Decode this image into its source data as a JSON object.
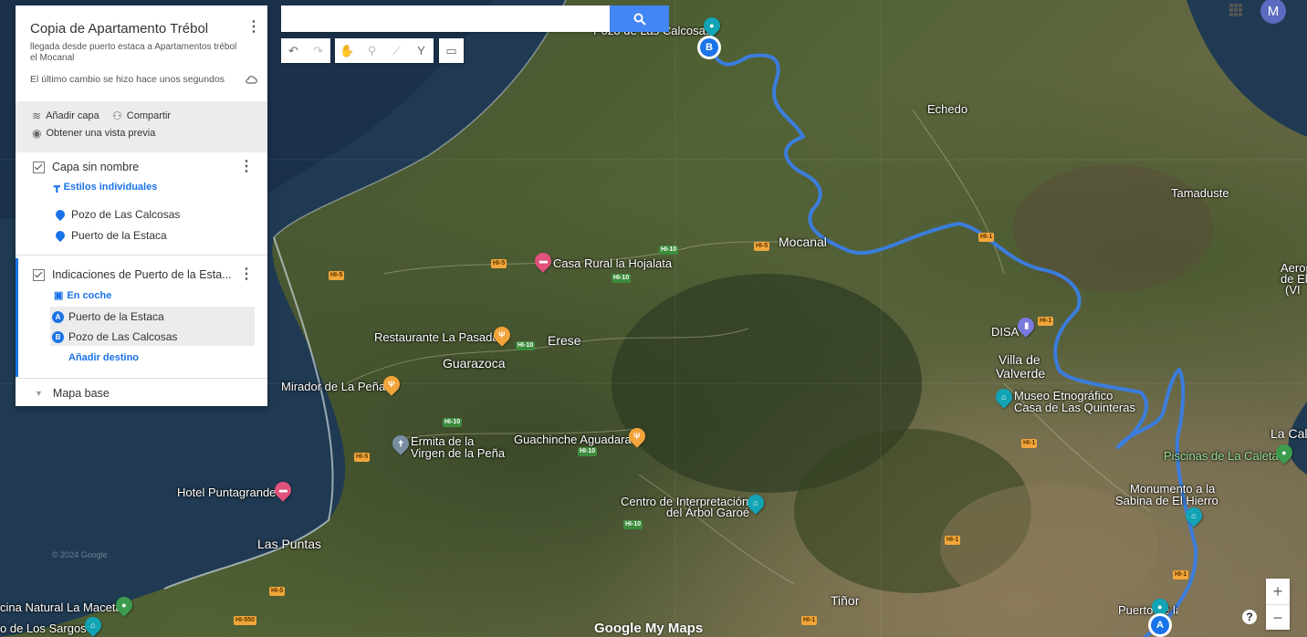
{
  "search": {
    "placeholder": ""
  },
  "toolbar": {
    "undo_icon": "undo-icon",
    "redo_icon": "redo-icon",
    "tools": [
      "hand-icon",
      "marker-icon",
      "draw-line-icon",
      "route-icon",
      "ruler-icon"
    ]
  },
  "panel": {
    "title": "Copia de Apartamento Trébol",
    "description": "llegada desde puerto estaca a Apartamentos trébol el Mocanal",
    "last_saved": "El último cambio se hizo hace unos segundos",
    "add_layer": "Añadir capa",
    "share": "Compartir",
    "preview": "Obtener una vista previa",
    "layer1": {
      "name": "Capa sin nombre",
      "style_link": "Estilos individuales",
      "items": [
        "Pozo de Las Calcosas",
        "Puerto de la Estaca"
      ]
    },
    "layer2": {
      "name": "Indicaciones de Puerto de la Esta...",
      "mode": "En coche",
      "stops": [
        {
          "badge": "A",
          "label": "Puerto de la Estaca"
        },
        {
          "badge": "B",
          "label": "Pozo de Las Calcosas"
        }
      ],
      "add_destination": "Añadir destino"
    },
    "base_map": "Mapa base"
  },
  "user": {
    "initial": "M"
  },
  "zoom": {
    "in": "+",
    "out": "−"
  },
  "help": "?",
  "brand": "Google My Maps",
  "copyright": "© 2024 Google",
  "places": {
    "pozo": "Pozo de Las Calcosas",
    "echedo": "Echedo",
    "tamaduste": "Tamaduste",
    "mocanal": "Mocanal",
    "casa_rural": "Casa Rural la Hojalata",
    "restaurante": "Restaurante La Pasada",
    "erese": "Erese",
    "guarazoca": "Guarazoca",
    "mirador": "Mirador de La Peña",
    "ermita1": "Ermita de la",
    "ermita2": "Virgen de la Peña",
    "guachinche": "Guachinche Aguadara",
    "hotel": "Hotel Puntagrande",
    "las_puntas": "Las Puntas",
    "centro1": "Centro de Interpretación",
    "centro2": "del Árbol Garoé",
    "disa": "DISA",
    "villa1": "Villa de",
    "villa2": "Valverde",
    "museo1": "Museo Etnográfico",
    "museo2": "Casa de Las Quinteras",
    "piscinas": "Piscinas de La Caleta",
    "la_caleta": "La Cal",
    "monumento1": "Monumento a la",
    "monumento2": "Sabina de El Hierro",
    "aerop1": "Aerop",
    "aerop2": "de El",
    "aerop3": "(VI",
    "tinor": "Tiñor",
    "puerto": "Puerto de la Estaca",
    "piscina_natural": "cina Natural La Maceta",
    "los_sargos": "o de Los Sargos"
  },
  "roads": [
    "HI-10",
    "HI-5",
    "HI-1",
    "HI-550"
  ],
  "colors": {
    "route": "#3b7ddd",
    "accent": "#1a73e8",
    "search_button": "#4285f4",
    "avatar": "#5c6bc0"
  }
}
